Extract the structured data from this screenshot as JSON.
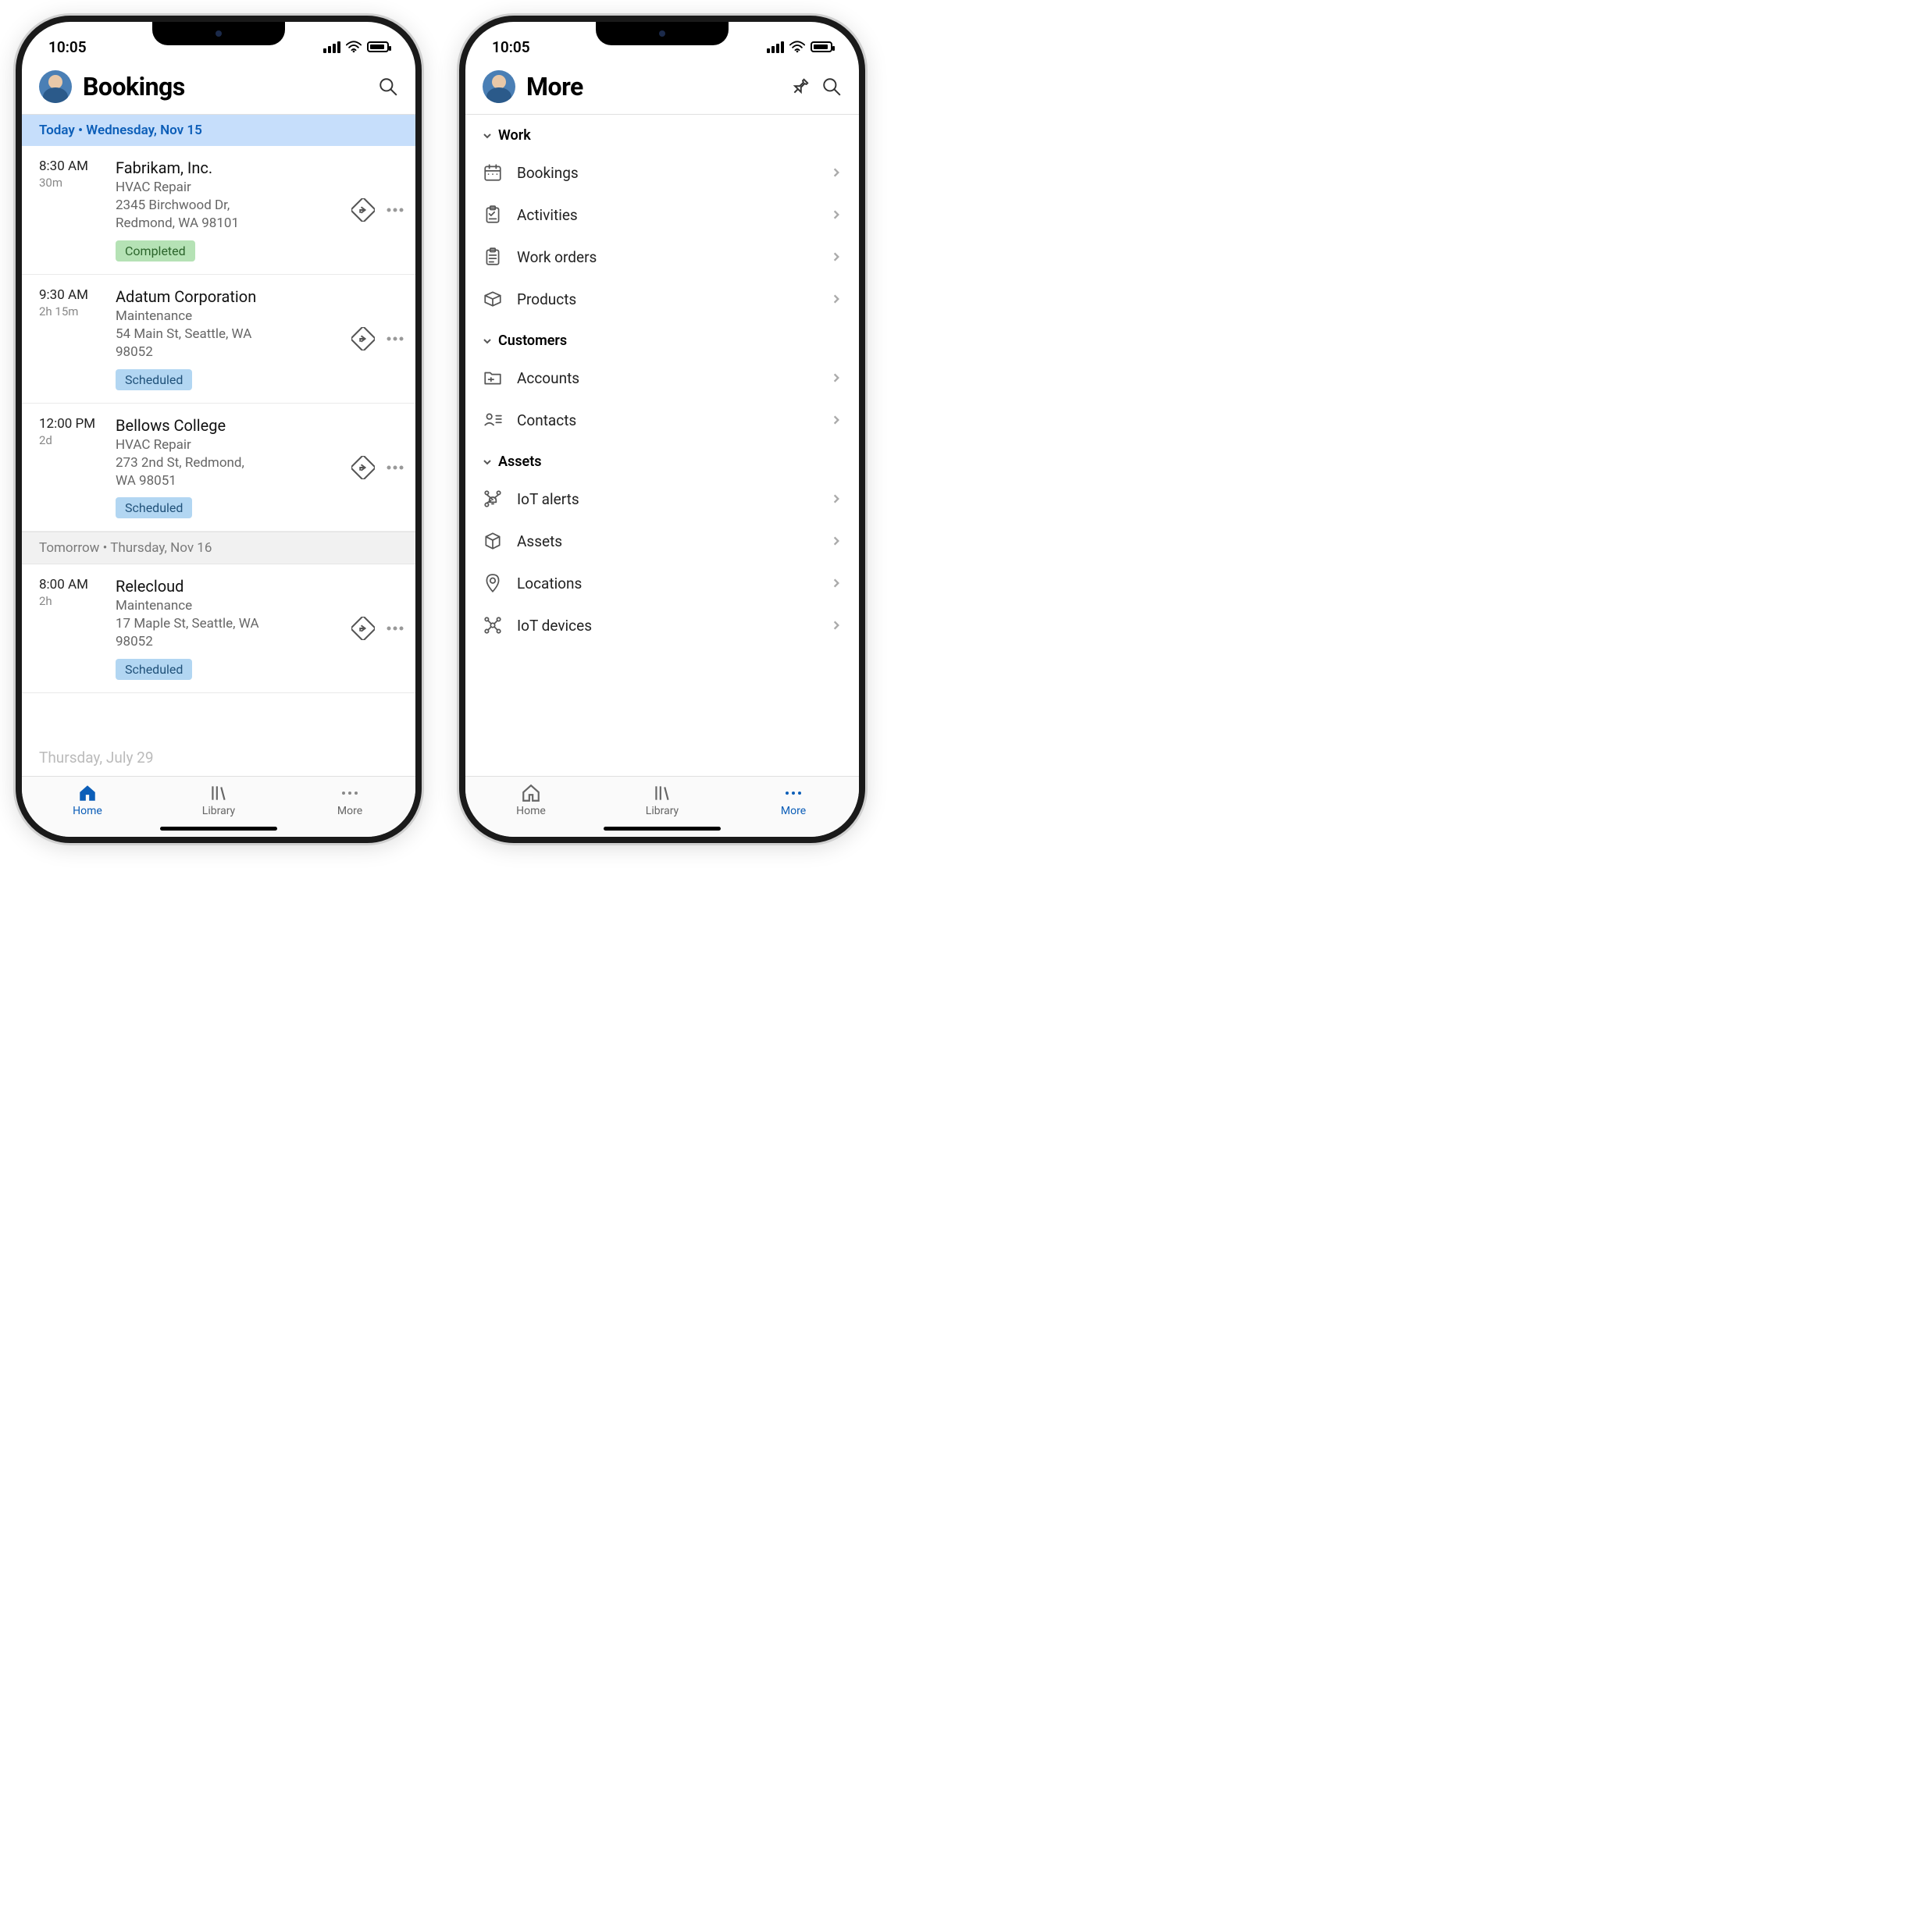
{
  "status": {
    "time": "10:05"
  },
  "bookings_screen": {
    "title": "Bookings",
    "today_header": "Today • Wednesday, Nov 15",
    "tomorrow_header": "Tomorrow • Thursday, Nov 16",
    "ghost_date": "Thursday, July 29",
    "bookings_today": [
      {
        "start": "8:30 AM",
        "duration": "30m",
        "customer": "Fabrikam, Inc.",
        "service": "HVAC Repair",
        "addr1": "2345 Birchwood Dr,",
        "addr2": "Redmond, WA 98101",
        "status": "Completed",
        "status_type": "completed"
      },
      {
        "start": "9:30 AM",
        "duration": "2h 15m",
        "customer": "Adatum Corporation",
        "service": "Maintenance",
        "addr1": "54 Main St, Seattle, WA",
        "addr2": "98052",
        "status": "Scheduled",
        "status_type": "scheduled"
      },
      {
        "start": "12:00 PM",
        "duration": "2d",
        "customer": "Bellows College",
        "service": "HVAC Repair",
        "addr1": "273 2nd St, Redmond,",
        "addr2": "WA 98051",
        "status": "Scheduled",
        "status_type": "scheduled"
      }
    ],
    "bookings_tomorrow": [
      {
        "start": "8:00 AM",
        "duration": "2h",
        "customer": "Relecloud",
        "service": "Maintenance",
        "addr1": "17 Maple St, Seattle, WA",
        "addr2": "98052",
        "status": "Scheduled",
        "status_type": "scheduled"
      }
    ]
  },
  "more_screen": {
    "title": "More",
    "sections": [
      {
        "header": "Work",
        "items": [
          {
            "label": "Bookings",
            "icon": "calendar"
          },
          {
            "label": "Activities",
            "icon": "checklist"
          },
          {
            "label": "Work orders",
            "icon": "clipboard"
          },
          {
            "label": "Products",
            "icon": "box"
          }
        ]
      },
      {
        "header": "Customers",
        "items": [
          {
            "label": "Accounts",
            "icon": "folder"
          },
          {
            "label": "Contacts",
            "icon": "contacts"
          }
        ]
      },
      {
        "header": "Assets",
        "items": [
          {
            "label": "IoT alerts",
            "icon": "iot-alert"
          },
          {
            "label": "Assets",
            "icon": "cube"
          },
          {
            "label": "Locations",
            "icon": "pin"
          },
          {
            "label": "IoT devices",
            "icon": "iot-device"
          }
        ]
      }
    ]
  },
  "tabs": {
    "home": "Home",
    "library": "Library",
    "more": "More"
  }
}
